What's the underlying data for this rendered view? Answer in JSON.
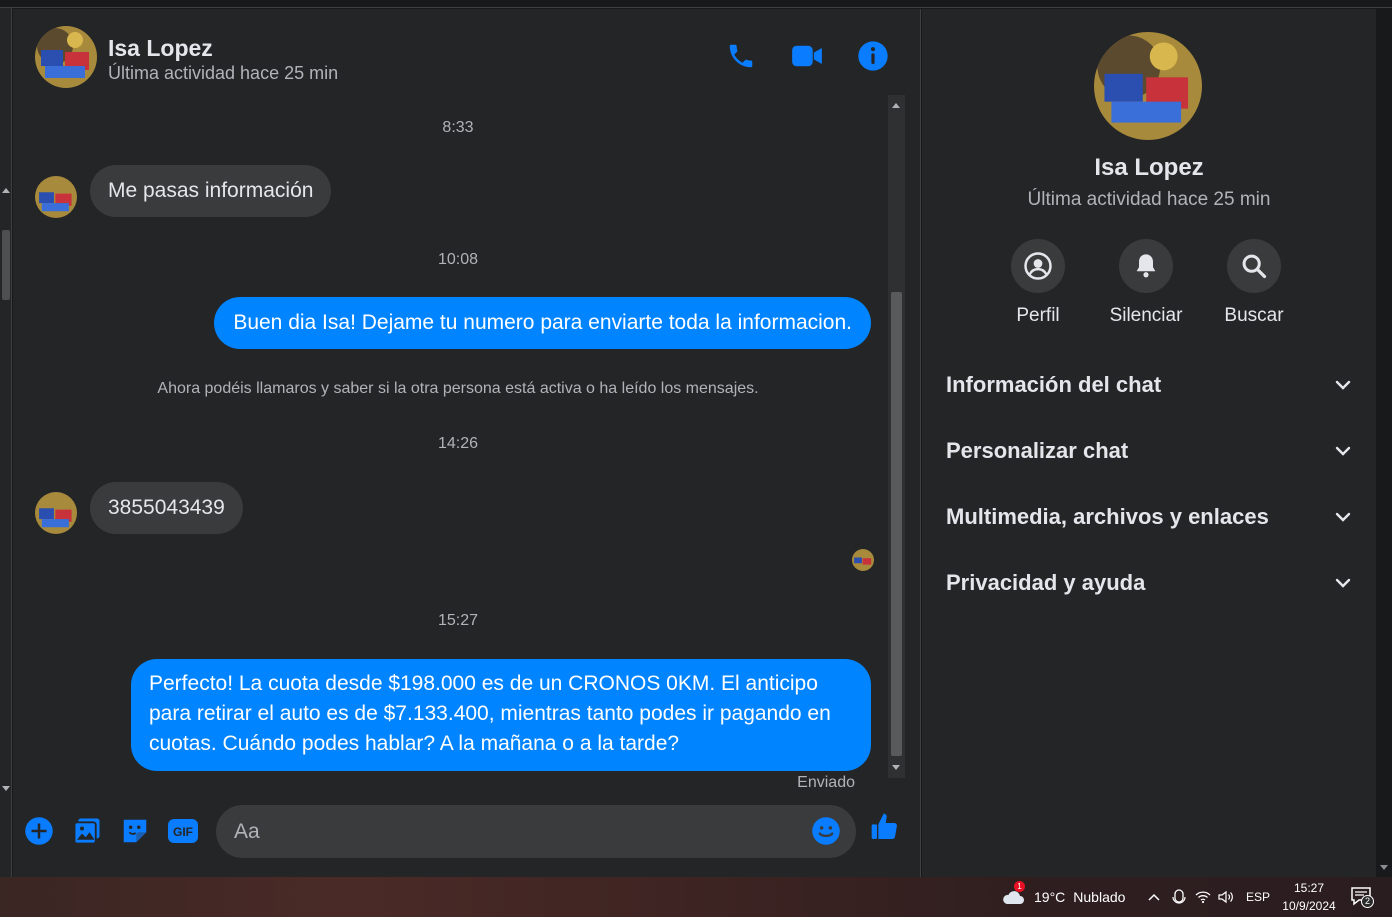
{
  "contact": {
    "name": "Isa Lopez",
    "last_active": "Última actividad hace 25 min"
  },
  "header_icons": [
    "phone-icon",
    "video-icon",
    "info-icon"
  ],
  "messages": [
    {
      "type": "timestamp",
      "text": "8:33"
    },
    {
      "type": "incoming",
      "text": "Me pasas información"
    },
    {
      "type": "timestamp",
      "text": "10:08"
    },
    {
      "type": "outgoing",
      "text": "Buen dia Isa! Dejame tu numero para enviarte toda la informacion."
    },
    {
      "type": "system",
      "text": "Ahora podéis llamaros y saber si la otra persona está activa o ha leído los mensajes."
    },
    {
      "type": "timestamp",
      "text": "14:26"
    },
    {
      "type": "incoming",
      "text": "3855043439"
    },
    {
      "type": "timestamp",
      "text": "15:27"
    },
    {
      "type": "outgoing",
      "text": "Perfecto! La cuota desde $198.000 es de un CRONOS 0KM. El anticipo para retirar el auto es de $7.133.400, mientras tanto podes ir pagando en cuotas. Cuándo podes hablar? A la mañana o a la tarde?"
    }
  ],
  "delivery_status": "Enviado",
  "composer": {
    "placeholder": "Aa",
    "icons": [
      "plus-icon",
      "image-icon",
      "sticker-icon",
      "gif-icon",
      "emoji-icon",
      "like-icon"
    ],
    "gif_label": "GIF"
  },
  "info_panel": {
    "name": "Isa Lopez",
    "last_active": "Última actividad hace 25 min",
    "actions": [
      {
        "label": "Perfil",
        "icon": "profile-icon"
      },
      {
        "label": "Silenciar",
        "icon": "bell-icon"
      },
      {
        "label": "Buscar",
        "icon": "search-icon"
      }
    ],
    "sections": [
      {
        "title": "Información del chat"
      },
      {
        "title": "Personalizar chat"
      },
      {
        "title": "Multimedia, archivos y enlaces"
      },
      {
        "title": "Privacidad y ayuda"
      }
    ]
  },
  "taskbar": {
    "weather_badge": "1",
    "temperature": "19°C",
    "weather": "Nublado",
    "language": "ESP",
    "time": "15:27",
    "date": "10/9/2024",
    "notification_count": "2"
  },
  "colors": {
    "accent": "#0084ff",
    "background": "#242526",
    "bubble_in": "#3a3b3c",
    "text_secondary": "#b0b3b8"
  }
}
